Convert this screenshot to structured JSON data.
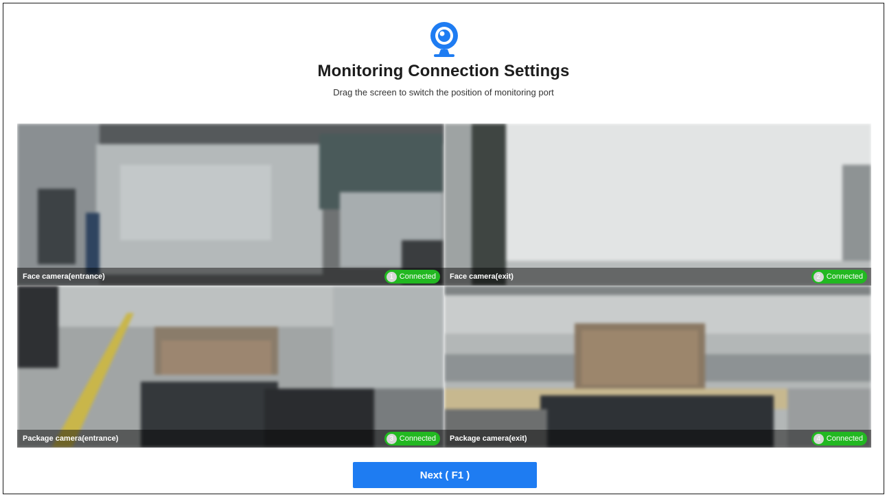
{
  "header": {
    "logo_icon": "webcam-icon",
    "title": "Monitoring Connection Settings",
    "subtitle": "Drag the screen to switch the position of monitoring port"
  },
  "cameras": [
    {
      "name": "Face camera(entrance)",
      "port": "1",
      "status": "Connected"
    },
    {
      "name": "Face camera(exit)",
      "port": "2",
      "status": "Connected"
    },
    {
      "name": "Package camera(entrance)",
      "port": "3",
      "status": "Connected"
    },
    {
      "name": "Package camera(exit)",
      "port": "4",
      "status": "Connected"
    }
  ],
  "footer": {
    "next_label": "Next ( F1 )"
  },
  "colors": {
    "accent": "#1e7cf2",
    "connected": "#22b821",
    "overlay": "#000000"
  }
}
